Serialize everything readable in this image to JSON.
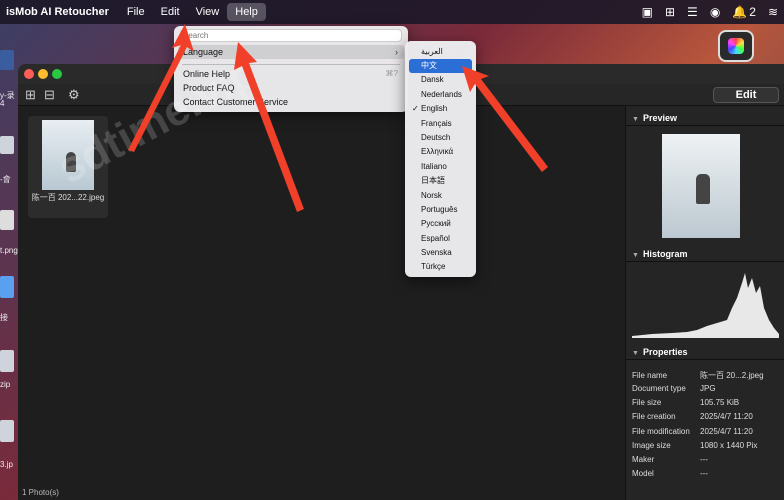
{
  "menubar": {
    "app_name": "isMob AI Retoucher",
    "items": [
      "File",
      "Edit",
      "View",
      "Help"
    ],
    "tray_badge": "2"
  },
  "desktop": {
    "labels": [
      "y-录",
      "4",
      "-會",
      "t.png",
      "接",
      "zip",
      "3.jp"
    ]
  },
  "help_menu": {
    "search_placeholder": "Search",
    "items": [
      {
        "label": "Language",
        "arrow": "›"
      },
      {
        "label": "Online Help",
        "shortcut": "⌘?"
      },
      {
        "label": "Product FAQ"
      },
      {
        "label": "Contact Customer Service"
      }
    ]
  },
  "language_menu": {
    "items": [
      "العربية",
      "中文",
      "Dansk",
      "Nederlands",
      "English",
      "Français",
      "Deutsch",
      "Ελληνικά",
      "Italiano",
      "日本語",
      "Norsk",
      "Português",
      "Русский",
      "Español",
      "Svenska",
      "Türkçe"
    ],
    "highlighted": "中文",
    "checked": "English",
    "check_mark": "✓"
  },
  "toolbar": {
    "edit_label": "Edit"
  },
  "grid": {
    "thumbnail_name": "陈一百 202...22.jpeg"
  },
  "panel": {
    "preview_title": "Preview",
    "histogram_title": "Histogram",
    "properties_title": "Properties",
    "properties": [
      {
        "key": "File name",
        "value": "陈一百 20...2.jpeg"
      },
      {
        "key": "Document type",
        "value": "JPG"
      },
      {
        "key": "File size",
        "value": "105.75 KiB"
      },
      {
        "key": "File creation",
        "value": "2025/4/7 11:20"
      },
      {
        "key": "File modification",
        "value": "2025/4/7 11:20"
      },
      {
        "key": "Image size",
        "value": "1080 x 1440 Pix"
      },
      {
        "key": "Maker",
        "value": "---"
      },
      {
        "key": "Model",
        "value": "---"
      }
    ]
  },
  "status": {
    "text": "1 Photo(s)"
  },
  "watermark": {
    "text": "sdtime.vip"
  },
  "colors": {
    "accent": "#2b6fd6",
    "arrow": "#f0402a"
  }
}
